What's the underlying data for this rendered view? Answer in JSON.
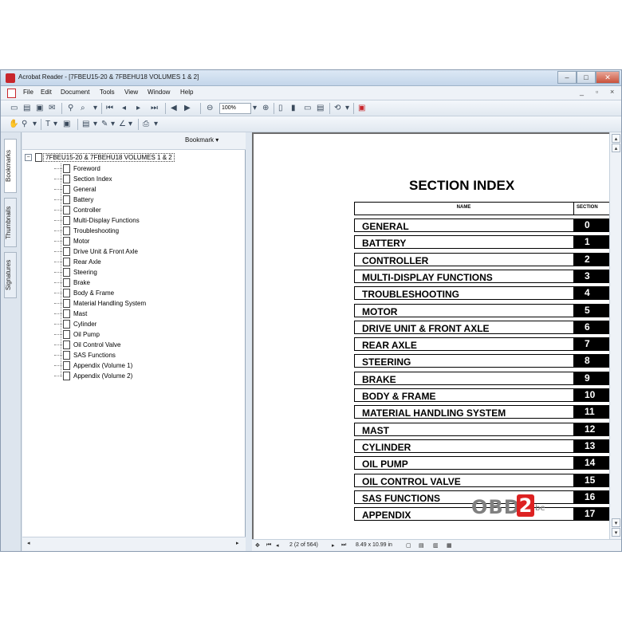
{
  "window": {
    "title": "Acrobat Reader - [7FBEU15-20 & 7FBEHU18 VOLUMES 1 & 2]",
    "minimize": "–",
    "maximize": "□",
    "close": "✕"
  },
  "menubar": {
    "items": [
      "File",
      "Edit",
      "Document",
      "Tools",
      "View",
      "Window",
      "Help"
    ],
    "doc_controls": [
      "_",
      "▫",
      "×"
    ]
  },
  "toolbar": {
    "zoom_value": "100%"
  },
  "sidetabs": [
    "Bookmarks",
    "Thumbnails",
    "Signatures"
  ],
  "bookmarks": {
    "header_label": "Bookmark ▾",
    "root": "7FBEU15-20 & 7FBEHU18 VOLUMES 1 & 2",
    "items": [
      "Foreword",
      "Section Index",
      "General",
      "Battery",
      "Controller",
      "Multi-Display Functions",
      "Troubleshooting",
      "Motor",
      "Drive Unit & Front Axle",
      "Rear Axle",
      "Steering",
      "Brake",
      "Body & Frame",
      "Material Handling System",
      "Mast",
      "Cylinder",
      "Oil Pump",
      "Oil Control Valve",
      "SAS Functions",
      "Appendix (Volume 1)",
      "Appendix (Volume 2)"
    ]
  },
  "document": {
    "heading": "SECTION INDEX",
    "col_name": "NAME",
    "col_section": "SECTION",
    "rows": [
      {
        "name": "GENERAL",
        "num": "0"
      },
      {
        "name": "BATTERY",
        "num": "1"
      },
      {
        "name": "CONTROLLER",
        "num": "2"
      },
      {
        "name": "MULTI-DISPLAY FUNCTIONS",
        "num": "3"
      },
      {
        "name": "TROUBLESHOOTING",
        "num": "4"
      },
      {
        "name": "MOTOR",
        "num": "5"
      },
      {
        "name": "DRIVE UNIT & FRONT AXLE",
        "num": "6"
      },
      {
        "name": "REAR AXLE",
        "num": "7"
      },
      {
        "name": "STEERING",
        "num": "8"
      },
      {
        "name": "BRAKE",
        "num": "9"
      },
      {
        "name": "BODY & FRAME",
        "num": "10"
      },
      {
        "name": "MATERIAL HANDLING SYSTEM",
        "num": "11"
      },
      {
        "name": "MAST",
        "num": "12"
      },
      {
        "name": "CYLINDER",
        "num": "13"
      },
      {
        "name": "OIL PUMP",
        "num": "14"
      },
      {
        "name": "OIL CONTROL VALVE",
        "num": "15"
      },
      {
        "name": "SAS FUNCTIONS",
        "num": "16"
      },
      {
        "name": "APPENDIX",
        "num": "17"
      }
    ]
  },
  "watermark": {
    "obd": "OBD",
    "two": "2",
    "be": "be"
  },
  "statusbar": {
    "page_indicator": "2  (2 of 564)",
    "page_size": "8.49 x 10.99 in"
  }
}
